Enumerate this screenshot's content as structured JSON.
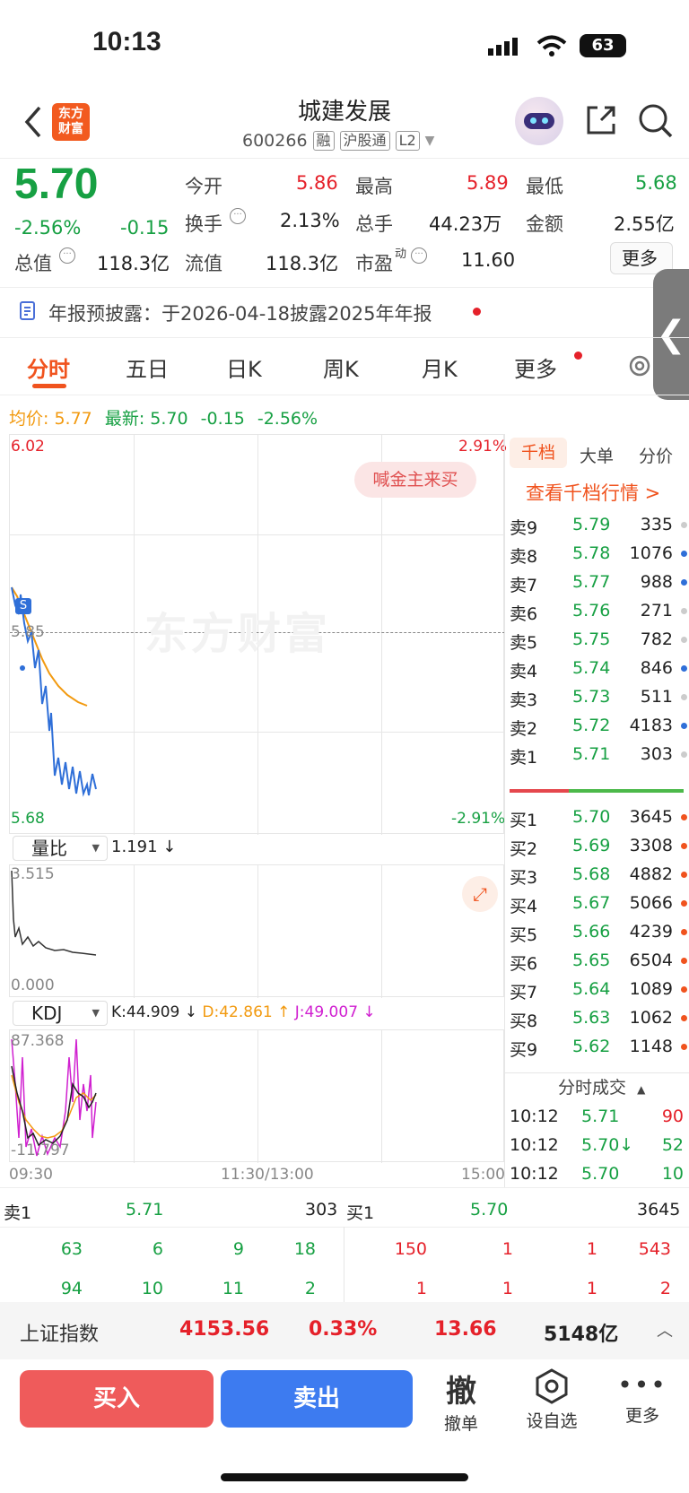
{
  "status": {
    "time": "10:13",
    "battery": "63"
  },
  "header": {
    "title": "城建发展",
    "code": "600266",
    "tags": [
      "融",
      "沪股通",
      "L2"
    ],
    "logo": "东方\n财富"
  },
  "quote": {
    "price": "5.70",
    "pct": "-2.56%",
    "chg": "-0.15",
    "open_label": "今开",
    "open": "5.86",
    "high_label": "最高",
    "high": "5.89",
    "low_label": "最低",
    "low": "5.68",
    "turnover_label": "换手",
    "turnover": "2.13%",
    "volume_label": "总手",
    "volume": "44.23万",
    "amount_label": "金额",
    "amount": "2.55亿",
    "mktcap_label": "总值",
    "mktcap": "118.3亿",
    "float_label": "流值",
    "float": "118.3亿",
    "pe_label": "市盈",
    "pe_sup": "动",
    "pe": "11.60",
    "more_label": "更多"
  },
  "notice": "年报预披露：于2026-04-18披露2025年年报",
  "tabs": [
    "分时",
    "五日",
    "日K",
    "周K",
    "月K",
    "更多"
  ],
  "avg_line": {
    "avg_label": "均价:",
    "avg": "5.77",
    "latest_label": "最新:",
    "latest": "5.70",
    "chg": "-0.15",
    "pct": "-2.56%"
  },
  "chart": {
    "top": "6.02",
    "top_pct": "2.91%",
    "mid": "5.85",
    "bottom": "5.68",
    "bottom_pct": "-2.91%",
    "watermark": "东方财富",
    "promo": "喊金主来买",
    "marker": "S"
  },
  "volratio": {
    "label": "量比",
    "value": "1.191 ↓",
    "top": "3.515",
    "bottom": "0.000"
  },
  "kdj": {
    "label": "KDJ",
    "k": "K:44.909 ↓",
    "d": "D:42.861 ↑",
    "j": "J:49.007 ↓",
    "top": "87.368",
    "bottom": "-11.797"
  },
  "time_axis": [
    "09:30",
    "11:30/13:00",
    "15:00"
  ],
  "orderbook": {
    "tabs": [
      "千档",
      "大单",
      "分价"
    ],
    "link": "查看千档行情 >",
    "sells": [
      {
        "label": "卖9",
        "price": "5.79",
        "vol": "335"
      },
      {
        "label": "卖8",
        "price": "5.78",
        "vol": "1076"
      },
      {
        "label": "卖7",
        "price": "5.77",
        "vol": "988"
      },
      {
        "label": "卖6",
        "price": "5.76",
        "vol": "271"
      },
      {
        "label": "卖5",
        "price": "5.75",
        "vol": "782"
      },
      {
        "label": "卖4",
        "price": "5.74",
        "vol": "846"
      },
      {
        "label": "卖3",
        "price": "5.73",
        "vol": "511"
      },
      {
        "label": "卖2",
        "price": "5.72",
        "vol": "4183"
      },
      {
        "label": "卖1",
        "price": "5.71",
        "vol": "303"
      }
    ],
    "buys": [
      {
        "label": "买1",
        "price": "5.70",
        "vol": "3645"
      },
      {
        "label": "买2",
        "price": "5.69",
        "vol": "3308"
      },
      {
        "label": "买3",
        "price": "5.68",
        "vol": "4882"
      },
      {
        "label": "买4",
        "price": "5.67",
        "vol": "5066"
      },
      {
        "label": "买5",
        "price": "5.66",
        "vol": "4239"
      },
      {
        "label": "买6",
        "price": "5.65",
        "vol": "6504"
      },
      {
        "label": "买7",
        "price": "5.64",
        "vol": "1089"
      },
      {
        "label": "买8",
        "price": "5.63",
        "vol": "1062"
      },
      {
        "label": "买9",
        "price": "5.62",
        "vol": "1148"
      }
    ],
    "trades_title": "分时成交",
    "trades": [
      {
        "time": "10:12",
        "price": "5.71",
        "vol": "90"
      },
      {
        "time": "10:12",
        "price": "5.70↓",
        "vol": "52"
      },
      {
        "time": "10:12",
        "price": "5.70",
        "vol": "10"
      }
    ]
  },
  "queue": {
    "sell_label": "卖1",
    "sell_price": "5.71",
    "sell_vol": "303",
    "buy_label": "买1",
    "buy_price": "5.70",
    "buy_vol": "3645",
    "sell_rows": [
      [
        "63",
        "6",
        "9",
        "18"
      ],
      [
        "94",
        "10",
        "11",
        "2"
      ]
    ],
    "buy_rows": [
      [
        "150",
        "1",
        "1",
        "543"
      ],
      [
        "1",
        "1",
        "1",
        "2"
      ]
    ]
  },
  "index_bar": {
    "name": "上证指数",
    "value": "4153.56",
    "pct": "0.33%",
    "chg": "13.66",
    "amount": "5148亿"
  },
  "bottom": {
    "buy": "买入",
    "sell": "卖出",
    "cancel_icon": "撤",
    "cancel": "撤单",
    "watch": "设自选",
    "more": "更多"
  }
}
